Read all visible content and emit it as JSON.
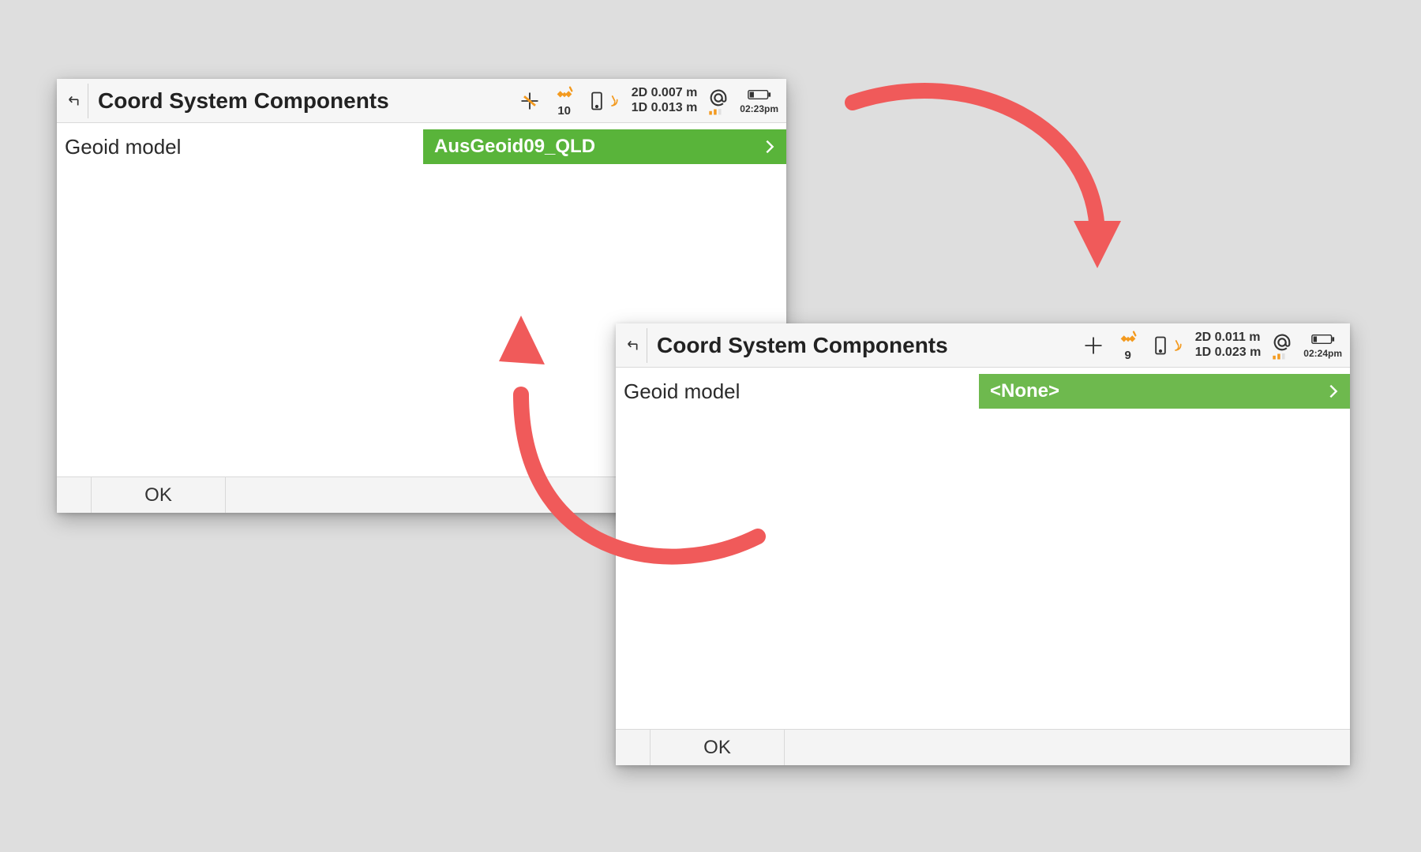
{
  "colors": {
    "accent_green": "#59b43a",
    "marker_red": "#f05a5a",
    "icon_orange": "#f39a1f"
  },
  "panel_a": {
    "title": "Coord System Components",
    "status": {
      "sat_count": "10",
      "precision_2d": "2D 0.007 m",
      "precision_1d": "1D 0.013 m",
      "time": "02:23pm"
    },
    "field_label": "Geoid model",
    "field_value": "AusGeoid09_QLD",
    "ok_label": "OK"
  },
  "panel_b": {
    "title": "Coord System Components",
    "status": {
      "sat_count": "9",
      "precision_2d": "2D 0.011 m",
      "precision_1d": "1D 0.023 m",
      "time": "02:24pm"
    },
    "field_label": "Geoid model",
    "field_value": "<None>",
    "ok_label": "OK"
  }
}
